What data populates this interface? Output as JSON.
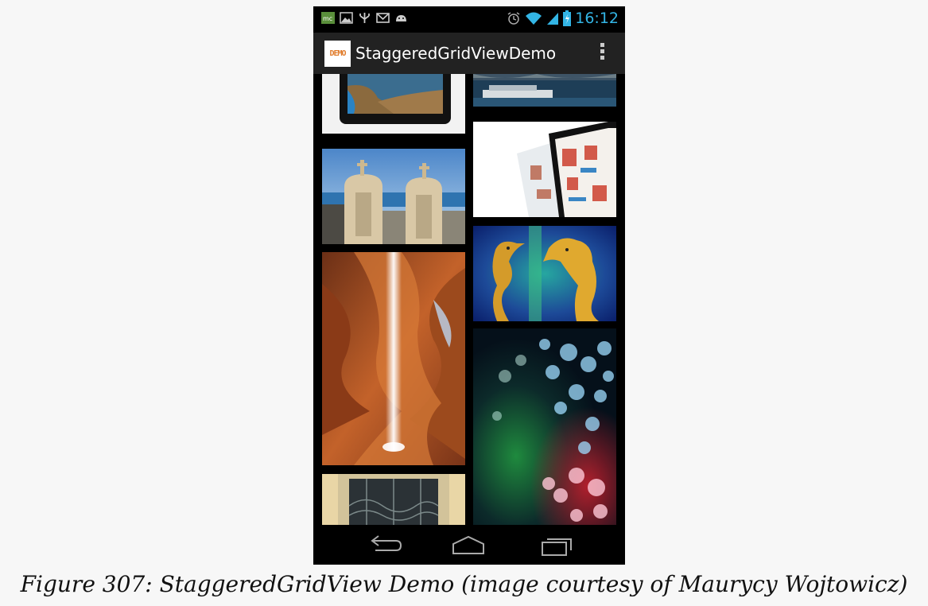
{
  "status_bar": {
    "time": "16:12",
    "left_icons": [
      "mc-icon",
      "image-icon",
      "usb-icon",
      "mail-icon",
      "android-icon"
    ],
    "right_icons": [
      "alarm-icon",
      "wifi-icon",
      "signal-icon",
      "battery-icon"
    ]
  },
  "action_bar": {
    "app_icon_text": "DEMO",
    "title": "StaggeredGridViewDemo",
    "overflow_icon": "overflow-menu-icon"
  },
  "grid": {
    "tiles": [
      {
        "subject": "tablet-with-coastline-photo"
      },
      {
        "subject": "river-boat-under-bridge"
      },
      {
        "subject": "tablet-with-magazine"
      },
      {
        "subject": "bell-towers-by-sea"
      },
      {
        "subject": "golden-seahorses"
      },
      {
        "subject": "slot-canyon-light-beam"
      },
      {
        "subject": "colorful-bokeh-lights"
      },
      {
        "subject": "ornate-window-grille"
      }
    ]
  },
  "nav_bar": {
    "buttons": [
      "back-icon",
      "home-icon",
      "recent-apps-icon"
    ]
  },
  "caption": "Figure 307: StaggeredGridView Demo (image courtesy of Maurycy Wojtowicz)",
  "colors": {
    "time_accent": "#33b5e5",
    "action_bar_bg": "#222222",
    "page_bg": "#f7f7f7"
  }
}
